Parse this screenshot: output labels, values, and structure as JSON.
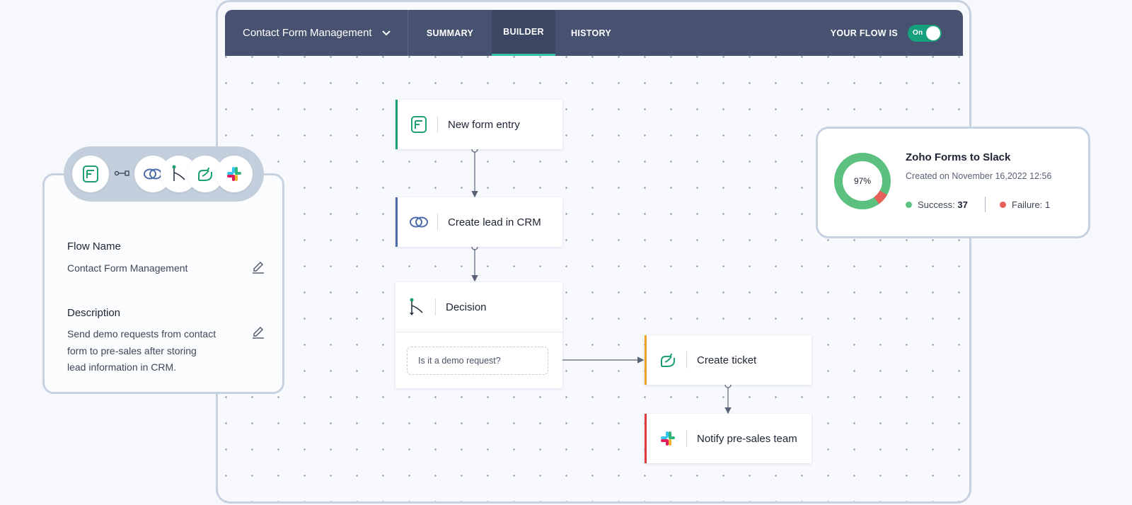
{
  "header": {
    "flow_name": "Contact Form Management",
    "tabs": [
      {
        "label": "SUMMARY"
      },
      {
        "label": "BUILDER"
      },
      {
        "label": "HISTORY"
      }
    ],
    "active_tab": "BUILDER",
    "flow_status_label": "YOUR FLOW IS",
    "toggle_label": "On"
  },
  "nodes": {
    "trigger": {
      "title": "New form entry",
      "icon": "zoho-forms-icon",
      "accent": "#1aa06d"
    },
    "crm": {
      "title": "Create lead in CRM",
      "icon": "zoho-crm-icon",
      "accent": "#4a6aa8"
    },
    "decision": {
      "title": "Decision",
      "icon": "decision-branch-icon",
      "condition": "Is it a demo request?"
    },
    "ticket": {
      "title": "Create ticket",
      "icon": "zoho-desk-icon",
      "accent": "#f0a12b"
    },
    "notify": {
      "title": "Notify pre-sales team",
      "icon": "slack-icon",
      "accent": "#e0393e"
    }
  },
  "flow_info": {
    "app_icons": [
      "zoho-forms-icon",
      "connector-icon",
      "zoho-crm-icon",
      "decision-branch-icon",
      "zoho-desk-icon",
      "slack-icon"
    ],
    "name_label": "Flow Name",
    "name_value": "Contact Form Management",
    "description_label": "Description",
    "description_lines": [
      "Send demo requests from contact",
      "form to pre-sales after storing",
      "lead information in CRM."
    ]
  },
  "stats": {
    "title": "Zoho Forms to Slack",
    "created": "Created on November 16,2022 12:56",
    "percent_label": "97%",
    "success_fraction": 0.97,
    "success_label": "Success:",
    "success_count": "37",
    "failure_label": "Failure:",
    "failure_count": "1",
    "success_color": "#5cc07f",
    "failure_color": "#e8605a"
  }
}
